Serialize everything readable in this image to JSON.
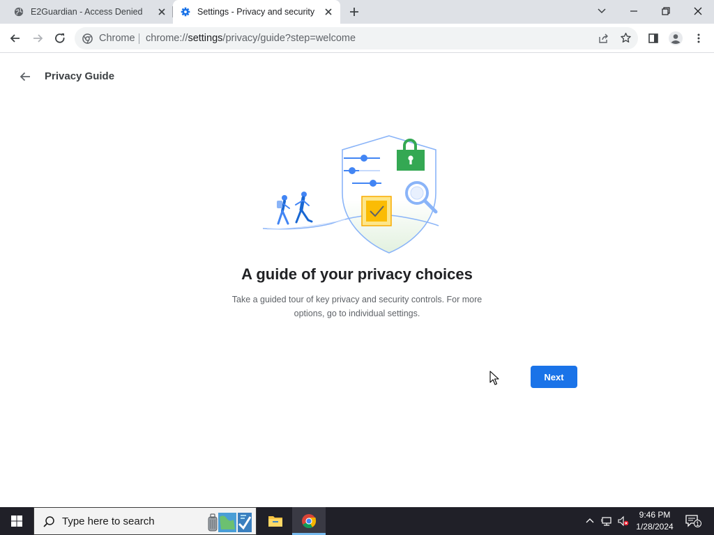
{
  "browser": {
    "tabs": [
      {
        "title": "E2Guardian - Access Denied",
        "active": false
      },
      {
        "title": "Settings - Privacy and security",
        "active": true
      }
    ],
    "omnibox": {
      "chip": "Chrome",
      "url_prefix": "chrome://",
      "url_host": "settings",
      "url_path": "/privacy/guide?step=welcome"
    }
  },
  "page": {
    "title": "Privacy Guide",
    "headline": "A guide of your privacy choices",
    "description": "Take a guided tour of key privacy and security controls. For more options, go to individual settings.",
    "next_label": "Next"
  },
  "taskbar": {
    "search_placeholder": "Type here to search",
    "time": "9:46 PM",
    "date": "1/28/2024",
    "notification_count": "1"
  },
  "colors": {
    "accent": "#1a73e8",
    "tabstrip": "#dee1e6",
    "taskbar": "#202028"
  },
  "icons": [
    "globe-icon",
    "gear-icon",
    "close-icon",
    "plus-icon",
    "chevron-down-icon",
    "minimize-icon",
    "restore-icon",
    "back-icon",
    "forward-icon",
    "reload-icon",
    "share-icon",
    "star-icon",
    "side-panel-icon",
    "profile-icon",
    "menu-icon",
    "windows-start-icon",
    "search-icon",
    "file-explorer-icon",
    "chrome-icon",
    "network-icon",
    "volume-muted-icon",
    "notification-icon"
  ]
}
